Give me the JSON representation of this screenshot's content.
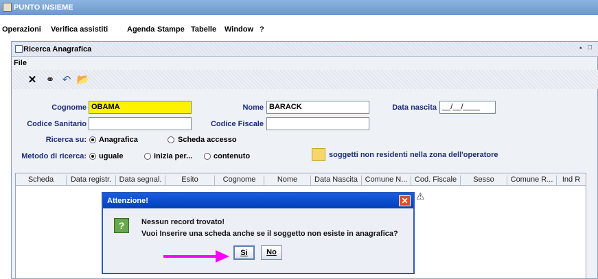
{
  "app": {
    "title": "PUNTO INSIEME"
  },
  "menubar": [
    "Operazioni",
    "Verifica assistiti",
    "Agenda",
    "Stampe",
    "Tabelle",
    "Window",
    "?"
  ],
  "frame": {
    "title": "Ricerca Anagrafica",
    "file_menu": "File"
  },
  "toolbar": {
    "icons": [
      "close-icon",
      "binoculars-icon",
      "undo-icon",
      "folder-icon"
    ]
  },
  "form": {
    "cognome_label": "Cognome",
    "cognome_value": "OBAMA",
    "nome_label": "Nome",
    "nome_value": "BARACK",
    "data_nascita_label": "Data nascita",
    "data_nascita_value": "__/__/____",
    "codice_sanitario_label": "Codice Sanitario",
    "codice_sanitario_value": "",
    "codice_fiscale_label": "Codice Fiscale",
    "codice_fiscale_value": "",
    "ricerca_su_label": "Ricerca su:",
    "ricerca_su_options": [
      "Anagrafica",
      "Scheda accesso"
    ],
    "metodo_label": "Metodo di ricerca:",
    "metodo_options": [
      "uguale",
      "inizia per...",
      "contenuto"
    ],
    "legend_text": "soggetti non residenti nella zona dell'operatore",
    "legend_color": "#f6d66a",
    "highlight_color": "#fff200"
  },
  "table": {
    "columns": [
      "Scheda",
      "Data registr.",
      "Data segnal.",
      "Esito",
      "Cognome",
      "Nome",
      "Data Nascita",
      "Comune N...",
      "Cod. Fiscale",
      "Sesso",
      "Comune R...",
      "Ind R"
    ]
  },
  "dialog": {
    "title": "Attenzione!",
    "line1": "Nessun record trovato!",
    "line2": "Vuoi Inserire una scheda anche se il soggetto non esiste in anagrafica?",
    "yes_label": "Si",
    "no_label": "No",
    "icon": "question-icon"
  },
  "colors": {
    "arrow": "#ff00ff",
    "dialog_title": "#1a5ce0"
  }
}
